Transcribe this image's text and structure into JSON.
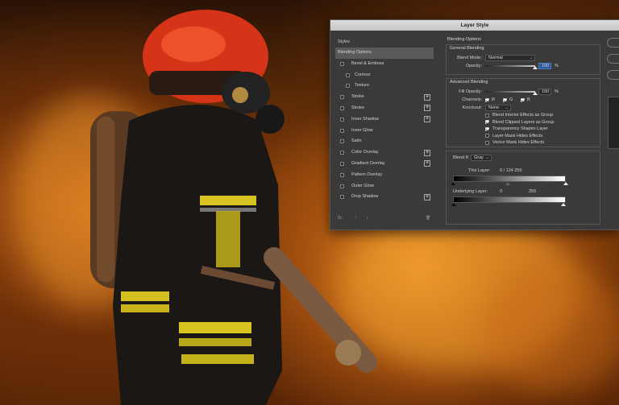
{
  "dialog": {
    "title": "Layer Style"
  },
  "styles_panel": {
    "header": "Styles",
    "items": [
      {
        "label": "Blending Options",
        "active": true,
        "checkbox": false,
        "sub": false,
        "plus": false
      },
      {
        "label": "Bevel & Emboss",
        "checkbox": true,
        "sub": false,
        "plus": false
      },
      {
        "label": "Contour",
        "checkbox": true,
        "sub": true,
        "plus": false
      },
      {
        "label": "Texture",
        "checkbox": true,
        "sub": true,
        "plus": false
      },
      {
        "label": "Stroke",
        "checkbox": true,
        "sub": false,
        "plus": true
      },
      {
        "label": "Stroke",
        "checkbox": true,
        "sub": false,
        "plus": true
      },
      {
        "label": "Inner Shadow",
        "checkbox": true,
        "sub": false,
        "plus": true
      },
      {
        "label": "Inner Glow",
        "checkbox": true,
        "sub": false,
        "plus": false
      },
      {
        "label": "Satin",
        "checkbox": true,
        "sub": false,
        "plus": false
      },
      {
        "label": "Color Overlay",
        "checkbox": true,
        "sub": false,
        "plus": true
      },
      {
        "label": "Gradient Overlay",
        "checkbox": true,
        "sub": false,
        "plus": true
      },
      {
        "label": "Pattern Overlay",
        "checkbox": true,
        "sub": false,
        "plus": false
      },
      {
        "label": "Outer Glow",
        "checkbox": true,
        "sub": false,
        "plus": false
      },
      {
        "label": "Drop Shadow",
        "checkbox": true,
        "sub": false,
        "plus": true
      }
    ],
    "footer": {
      "fx": "fx.",
      "up": "↑",
      "down": "↓",
      "trash": "🗑"
    }
  },
  "blending": {
    "title": "Blending Options",
    "general": {
      "title": "General Blending",
      "blend_mode_label": "Blend Mode:",
      "blend_mode_value": "Normal",
      "opacity_label": "Opacity:",
      "opacity_value": "100",
      "opacity_unit": "%",
      "opacity_level": 1.0
    },
    "advanced": {
      "title": "Advanced Blending",
      "fill_opacity_label": "Fill Opacity:",
      "fill_opacity_value": "100",
      "fill_opacity_unit": "%",
      "fill_opacity_level": 1.0,
      "channels_label": "Channels:",
      "channels": [
        {
          "label": "R",
          "checked": true
        },
        {
          "label": "G",
          "checked": true
        },
        {
          "label": "B",
          "checked": true
        }
      ],
      "knockout_label": "Knockout:",
      "knockout_value": "None",
      "options": [
        {
          "label": "Blend Interior Effects as Group",
          "checked": false
        },
        {
          "label": "Blend Clipped Layers as Group",
          "checked": true
        },
        {
          "label": "Transparency Shapes Layer",
          "checked": true
        },
        {
          "label": "Layer Mask Hides Effects",
          "checked": false
        },
        {
          "label": "Vector Mask Hides Effects",
          "checked": false
        }
      ]
    },
    "blend_if": {
      "label": "Blend If:",
      "value": "Gray",
      "this_layer_label": "This Layer:",
      "this_layer_values": "0  /  124     255",
      "underlying_label": "Underlying Layer:",
      "underlying_low": "0",
      "underlying_high": "255",
      "this_layer_low": 0,
      "this_layer_split": 124,
      "this_layer_high": 255
    }
  }
}
